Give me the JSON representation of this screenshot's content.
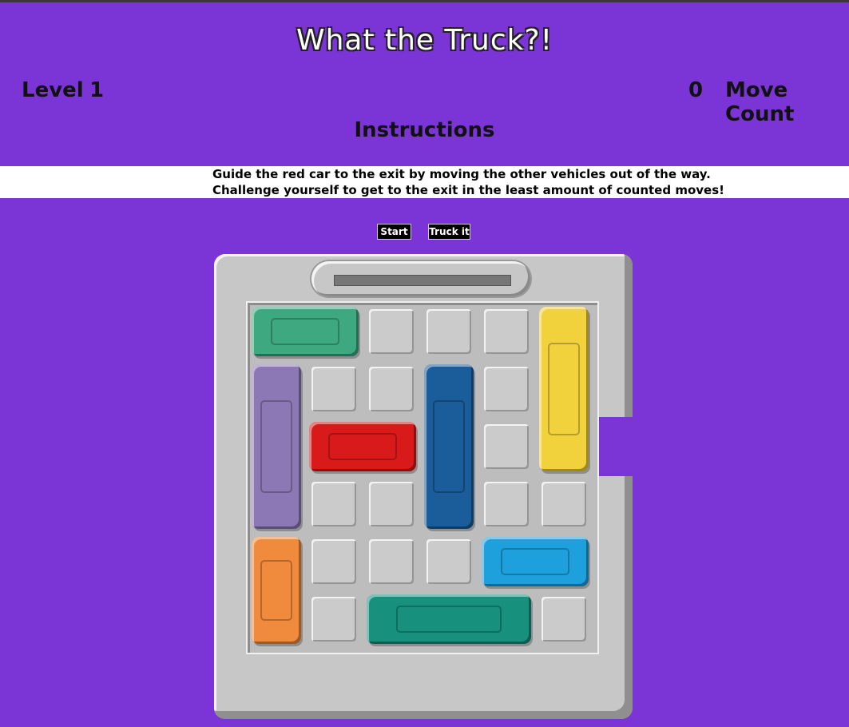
{
  "title": "What the Truck?!",
  "level": {
    "label": "Level",
    "value": "1"
  },
  "moves": {
    "label": "Move Count",
    "value": "0"
  },
  "instructions": {
    "heading": "Instructions",
    "line1": "Guide the red car to the exit by moving the other vehicles out of the way.",
    "line2": "Challenge yourself to get to the exit in the least amount of counted moves!"
  },
  "buttons": {
    "start": "Start",
    "truck_it": "Truck it"
  },
  "board": {
    "rows": 6,
    "cols": 6,
    "exit_row": 3,
    "vehicles": [
      {
        "name": "green-car",
        "kind": "car",
        "color": "#3ea880",
        "row": 1,
        "col": 1,
        "orientation": "horizontal",
        "length": 2
      },
      {
        "name": "purple-truck",
        "kind": "truck",
        "color": "#8c78b4",
        "row": 2,
        "col": 1,
        "orientation": "vertical",
        "length": 3
      },
      {
        "name": "red-car",
        "kind": "car",
        "color": "#d81a1a",
        "row": 3,
        "col": 2,
        "orientation": "horizontal",
        "length": 2
      },
      {
        "name": "blue-truck",
        "kind": "truck",
        "color": "#1a5d9a",
        "row": 2,
        "col": 4,
        "orientation": "vertical",
        "length": 3
      },
      {
        "name": "yellow-truck",
        "kind": "truck",
        "color": "#f2d23c",
        "row": 1,
        "col": 6,
        "orientation": "vertical",
        "length": 3
      },
      {
        "name": "orange-car",
        "kind": "car",
        "color": "#f08a3c",
        "row": 5,
        "col": 1,
        "orientation": "vertical",
        "length": 2
      },
      {
        "name": "cyan-car",
        "kind": "car",
        "color": "#1ea0dc",
        "row": 5,
        "col": 5,
        "orientation": "horizontal",
        "length": 2
      },
      {
        "name": "teal-truck",
        "kind": "truck",
        "color": "#17907e",
        "row": 6,
        "col": 3,
        "orientation": "horizontal",
        "length": 3
      }
    ]
  }
}
